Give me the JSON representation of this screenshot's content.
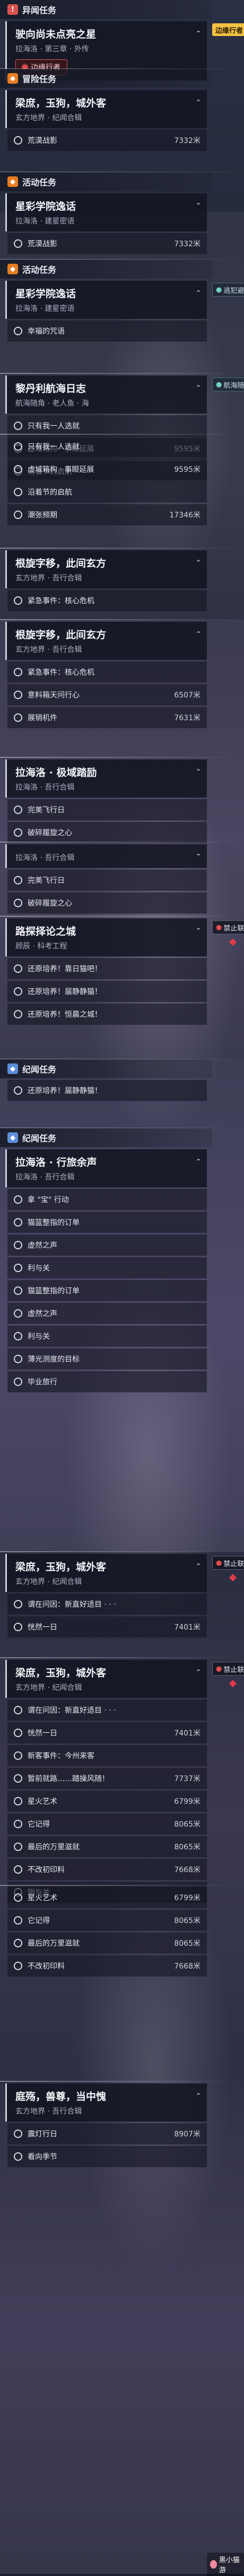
{
  "sections": [
    {
      "header": {
        "icon": "!",
        "label": "异闻任务",
        "color": "red"
      },
      "card": {
        "title": "驶向尚未点亮之星",
        "subtitle": "拉海洛 · 第三章 · 外传"
      },
      "pill": "边缘行者",
      "tags": [
        {
          "text": "边缘行者",
          "style": "yellow"
        }
      ],
      "rows": []
    },
    {
      "header": {
        "icon": "◆",
        "label": "冒险任务",
        "color": "orange"
      },
      "card": {
        "title": "梁庶，玉狗，城外客",
        "subtitle": "玄方地界 · 纪闻合辑"
      },
      "rows": [
        {
          "text": "荒漠战影",
          "dist": "7332米"
        }
      ]
    },
    {
      "header": {
        "icon": "◆",
        "label": "活动任务",
        "color": "orange"
      },
      "card": {
        "title": "星彩学院逸话",
        "subtitle": "拉海洛 · 建星密语"
      },
      "rows": [
        {
          "text": "荒漠战影",
          "dist": "7332米"
        }
      ]
    },
    {
      "header": {
        "icon": "◆",
        "label": "活动任务",
        "color": "orange"
      },
      "card": {
        "title": "星彩学院逸话",
        "subtitle": "拉海洛 · 建星密语"
      },
      "tags": [
        {
          "text": "逃犯避险",
          "style": "teal"
        }
      ],
      "rows": [
        {
          "text": "幸福的咒语",
          "dist": ""
        }
      ]
    },
    {
      "header": null,
      "card": {
        "title": "黎丹利航海日志",
        "subtitle": "航海随角 · 老人鱼 · 海"
      },
      "tags": [
        {
          "text": "航海随角",
          "style": "teal"
        }
      ],
      "rows": [
        {
          "text": "只有我一人选就",
          "dist": ""
        },
        {
          "text": "虚域箱构 · 事眼延展",
          "dist": "9595米"
        },
        {
          "text": "沿着节的启航",
          "dist": ""
        }
      ]
    },
    {
      "header": null,
      "card": null,
      "rows": [
        {
          "text": "只有我一人选就",
          "dist": ""
        },
        {
          "text": "虚域箱构 · 事眼延展",
          "dist": "9595米"
        },
        {
          "text": "沿着节的启航",
          "dist": ""
        },
        {
          "text": "潮张频期",
          "dist": "17346米"
        }
      ]
    },
    {
      "header": null,
      "card": {
        "title": "根旋字移，此间玄方",
        "subtitle": "玄方地界 · 吾行合辑"
      },
      "rows": [
        {
          "text": "紧急事件：核心危机",
          "dist": ""
        }
      ]
    },
    {
      "header": null,
      "card": {
        "title": "根旋字移，此间玄方",
        "subtitle": "玄方地界 · 吾行合辑"
      },
      "rows": [
        {
          "text": "紧急事件：核心危机",
          "dist": ""
        },
        {
          "text": "意料箱天问行心",
          "dist": "6507米"
        },
        {
          "text": "展销机件",
          "dist": "7631米"
        }
      ]
    },
    {
      "header": null,
      "card": {
        "title": "拉海洛 · 极域踏励",
        "subtitle": "拉海洛 · 吾行合辑"
      },
      "rows": [
        {
          "text": "完美飞行日",
          "dist": ""
        },
        {
          "text": "破碎履旋之心",
          "dist": ""
        }
      ]
    },
    {
      "header": null,
      "card": {
        "title": "",
        "subtitle": "拉海洛 · 吾行合辑"
      },
      "rows": [
        {
          "text": "完美飞行日",
          "dist": ""
        },
        {
          "text": "破碎履旋之心",
          "dist": ""
        }
      ]
    },
    {
      "header": null,
      "card": {
        "title": "路探择论之城",
        "subtitle": "顾辰 · 科考工程"
      },
      "tags": [
        {
          "text": "禁止联机",
          "style": "dark"
        }
      ],
      "rows": [
        {
          "text": "还原培养！靠日猫吧！",
          "dist": ""
        },
        {
          "text": "还原培养！届静静猫！",
          "dist": ""
        },
        {
          "text": "还原培养！恒晨之城！",
          "dist": ""
        }
      ]
    },
    {
      "header": {
        "icon": "◆",
        "label": "纪闻任务",
        "color": "blue"
      },
      "card": null,
      "rows": [
        {
          "text": "还原培养！届静静猫！",
          "dist": ""
        }
      ]
    },
    {
      "header": {
        "icon": "◆",
        "label": "纪闻任务",
        "color": "blue"
      },
      "card": {
        "title": "拉海洛 · 行旅余声",
        "subtitle": "拉海洛 · 吾行合辑"
      },
      "rows": [
        {
          "text": "拿 \"宝\" 行动",
          "dist": ""
        },
        {
          "text": "猫篮整指的订单",
          "dist": ""
        },
        {
          "text": "虚然之声",
          "dist": ""
        },
        {
          "text": "利与关",
          "dist": ""
        },
        {
          "text": "猫篮整指的订单",
          "dist": ""
        },
        {
          "text": "虚然之声",
          "dist": ""
        },
        {
          "text": "利与关",
          "dist": ""
        },
        {
          "text": "薄光测度的目标",
          "dist": ""
        },
        {
          "text": "毕业旅行",
          "dist": ""
        }
      ]
    },
    {
      "header": null,
      "card": {
        "title": "梁庶，玉狗，城外客",
        "subtitle": "玄方地界 · 纪闻合辑"
      },
      "tags": [
        {
          "text": "禁止联机",
          "style": "dark"
        }
      ],
      "rows": [
        {
          "text": "谓在问因：新直好适目 · · ·",
          "dist": ""
        },
        {
          "text": "恍然一日",
          "dist": "7401米"
        }
      ]
    },
    {
      "header": null,
      "card": {
        "title": "梁庶，玉狗，城外客",
        "subtitle": "玄方地界 · 纪闻合辑"
      },
      "tags": [
        {
          "text": "禁止联机",
          "style": "dark"
        }
      ],
      "rows": [
        {
          "text": "谓在问因：新直好适目 · · ·",
          "dist": ""
        },
        {
          "text": "恍然一日",
          "dist": "7401米"
        },
        {
          "text": "新客事件：今州来客",
          "dist": ""
        },
        {
          "text": "暂前就路……踏操风随！",
          "dist": "7737米"
        },
        {
          "text": "星火艺术",
          "dist": "6799米"
        },
        {
          "text": "它记得",
          "dist": "8065米"
        },
        {
          "text": "最后的万里滋就",
          "dist": "8065米"
        },
        {
          "text": "不改初印料",
          "dist": "7668米"
        },
        {
          "text": "刚与关",
          "dist": ""
        }
      ]
    },
    {
      "header": null,
      "card": null,
      "rows": [
        {
          "text": "星火艺术",
          "dist": "6799米"
        },
        {
          "text": "它记得",
          "dist": "8065米"
        },
        {
          "text": "最后的万里滋就",
          "dist": "8065米"
        },
        {
          "text": "不改初印料",
          "dist": "7668米"
        }
      ]
    },
    {
      "header": null,
      "card": {
        "title": "庭殇，兽尊，当中愧",
        "subtitle": "玄方地界 · 吾行合辑"
      },
      "rows": [
        {
          "text": "震灯行日",
          "dist": "8907米"
        },
        {
          "text": "看向季节",
          "dist": ""
        }
      ]
    }
  ],
  "watermark": "黑小猫游",
  "colors": {
    "red": "#d9534f",
    "orange": "#e67e22",
    "blue": "#5b8fd9",
    "pill_dot": "#e34b4b"
  }
}
